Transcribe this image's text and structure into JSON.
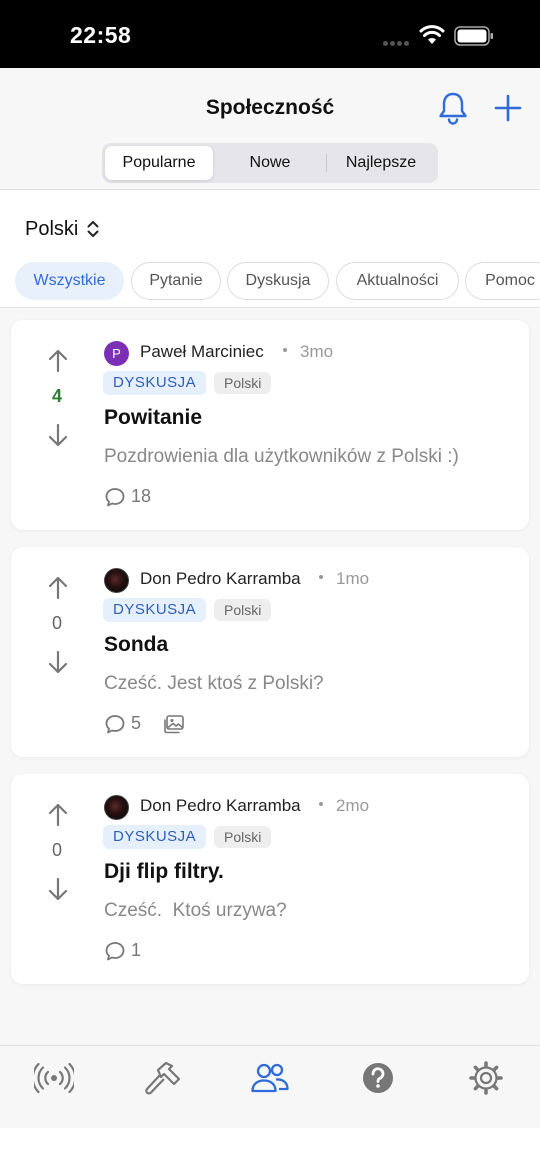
{
  "status_bar": {
    "time": "22:58"
  },
  "header": {
    "title": "Społeczność",
    "bell_icon": "bell-icon",
    "add_icon": "plus-icon",
    "segments": [
      "Popularne",
      "Nowe",
      "Najlepsze"
    ],
    "selected_segment": "Popularne"
  },
  "language": {
    "label": "Polski",
    "icon": "chevron-up-down-icon"
  },
  "filters": {
    "chips": [
      "Wszystkie",
      "Pytanie",
      "Dyskusja",
      "Aktualności",
      "Pomoc"
    ],
    "active": "Wszystkie"
  },
  "posts": [
    {
      "votes": "4",
      "avatar_letter": "P",
      "author": "Paweł Marciniec",
      "age": "3mo",
      "type": "DYSKUSJA",
      "language": "Polski",
      "title": "Powitanie",
      "body": "Pozdrowienia dla użytkowników z Polski :)",
      "comments": "18"
    },
    {
      "votes": "0",
      "author": "Don Pedro Karramba",
      "age": "1mo",
      "type": "DYSKUSJA",
      "language": "Polski",
      "title": "Sonda",
      "body": "Cześć. Jest ktoś z Polski?",
      "comments": "5",
      "has_image": true
    },
    {
      "votes": "0",
      "author": "Don Pedro Karramba",
      "age": "2mo",
      "type": "DYSKUSJA",
      "language": "Polski",
      "title": "Dji flip filtry.",
      "body": "Cześć.  Ktoś urzywa?",
      "comments": "1"
    }
  ],
  "tabbar": {
    "tabs": [
      "broadcast-icon",
      "hammer-icon",
      "community-icon",
      "help-icon",
      "settings-icon"
    ],
    "active": "community-icon"
  },
  "colors": {
    "accent": "#2f6bd9",
    "positive_vote": "#2e7d32",
    "tag_bg": "#e6effc",
    "avatar_purple": "#7b2fb5"
  }
}
